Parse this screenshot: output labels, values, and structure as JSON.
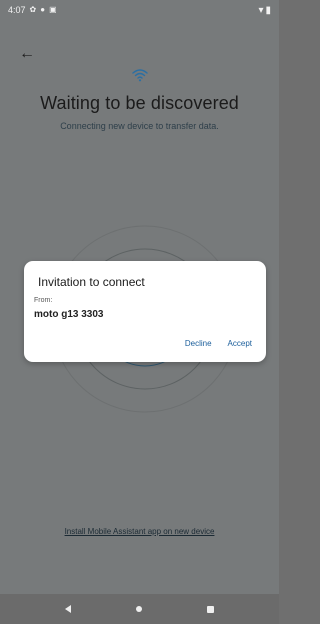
{
  "status_bar": {
    "time": "4:07",
    "left_icons": [
      "settings-icon",
      "location-icon",
      "notification-icon"
    ],
    "right_icons": [
      "wifi-icon",
      "battery-icon"
    ]
  },
  "header": {
    "back_icon": "arrow-left-icon"
  },
  "main": {
    "status_icon": "wifi-icon",
    "title": "Waiting to be discovered",
    "subtitle": "Connecting new device to transfer data."
  },
  "dialog": {
    "title": "Invitation to connect",
    "from_label": "From:",
    "device_name": "moto g13 3303",
    "decline_label": "Decline",
    "accept_label": "Accept"
  },
  "footer": {
    "install_link": "Install Mobile Assistant app on new device"
  },
  "nav": {
    "items": [
      "back-icon",
      "home-icon",
      "recents-icon"
    ]
  },
  "colors": {
    "background_dimmed": "#777a7b",
    "accent": "#1b5e9b",
    "dialog_bg": "#ffffff",
    "wifi_icon": "#2b6fa3"
  }
}
